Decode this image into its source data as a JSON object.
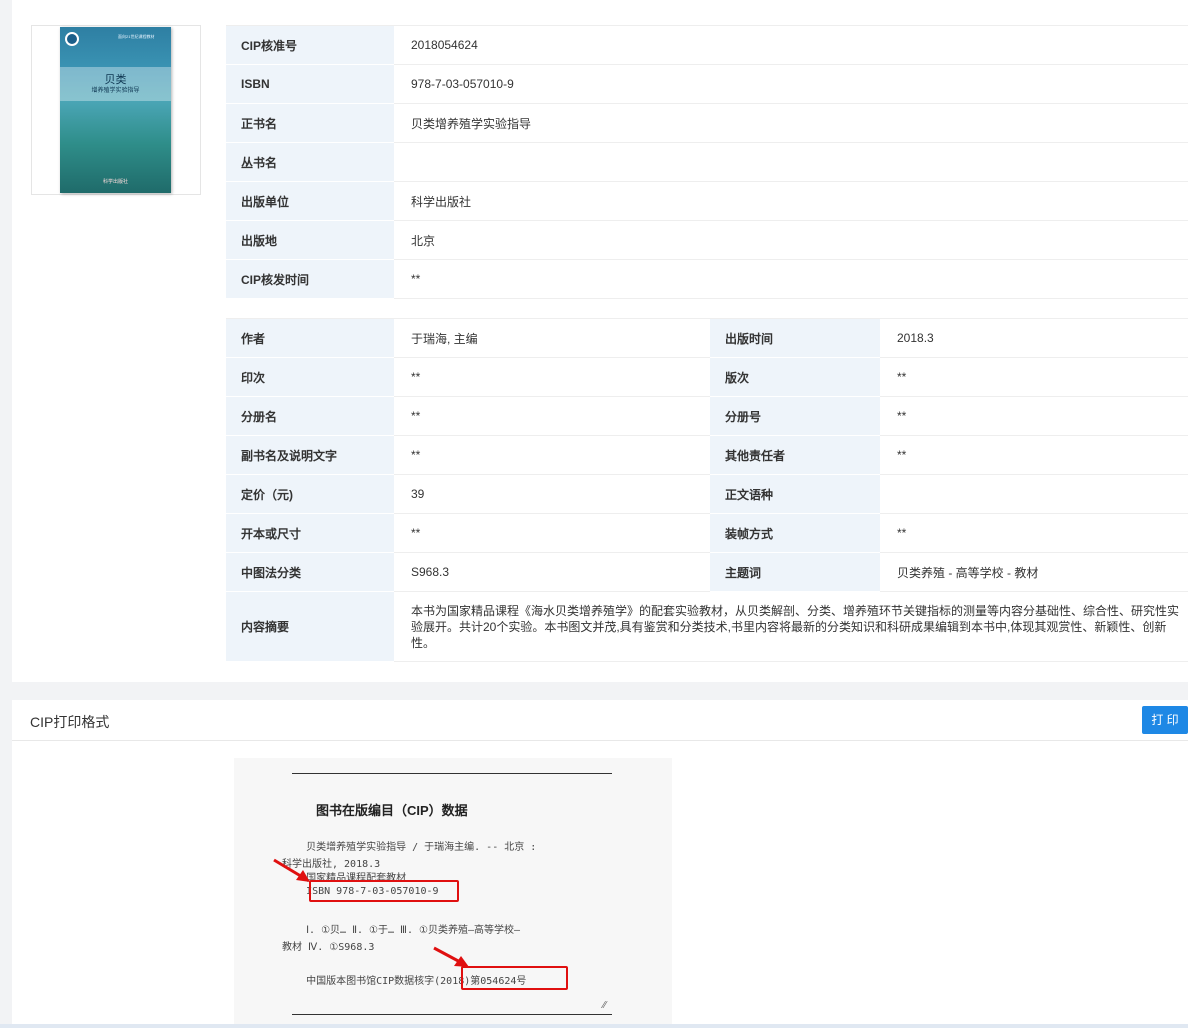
{
  "cover": {
    "series_line": "面向21世纪课程教材",
    "title_main": "贝类",
    "title_sub": "增养殖学实验指导",
    "publisher_mark": "科学出版社"
  },
  "basic_info": [
    {
      "label": "CIP核准号",
      "value": "2018054624"
    },
    {
      "label": "ISBN",
      "value": "978-7-03-057010-9"
    },
    {
      "label": "正书名",
      "value": "贝类增养殖学实验指导"
    },
    {
      "label": "丛书名",
      "value": ""
    },
    {
      "label": "出版单位",
      "value": "科学出版社"
    },
    {
      "label": "出版地",
      "value": "北京"
    },
    {
      "label": "CIP核发时间",
      "value": "**"
    }
  ],
  "detail_info": [
    {
      "l1": "作者",
      "v1": "于瑞海, 主编",
      "l2": "出版时间",
      "v2": "2018.3"
    },
    {
      "l1": "印次",
      "v1": "**",
      "l2": "版次",
      "v2": "**"
    },
    {
      "l1": "分册名",
      "v1": "**",
      "l2": "分册号",
      "v2": "**"
    },
    {
      "l1": "副书名及说明文字",
      "v1": "**",
      "l2": "其他责任者",
      "v2": "**"
    },
    {
      "l1": "定价（元)",
      "v1": "39",
      "l2": "正文语种",
      "v2": ""
    },
    {
      "l1": "开本或尺寸",
      "v1": "**",
      "l2": "装帧方式",
      "v2": "**"
    },
    {
      "l1": "中图法分类",
      "v1": "S968.3",
      "l2": "主题词",
      "v2": "贝类养殖 - 高等学校 - 教材"
    }
  ],
  "abstract": {
    "label": "内容摘要",
    "text": "本书为国家精品课程《海水贝类增养殖学》的配套实验教材，从贝类解剖、分类、增养殖环节关键指标的测量等内容分基础性、综合性、研究性实验展开。共计20个实验。本书图文并茂,具有鉴赏和分类技术,书里内容将最新的分类知识和科研成果编辑到本书中,体现其观赏性、新颖性、创新性。"
  },
  "print_section": {
    "title": "CIP打印格式",
    "print_button": "打 印"
  },
  "cip_record": {
    "heading": "图书在版编目（CIP）数据",
    "line1": "    贝类增养殖学实验指导 / 于瑞海主编. -- 北京 :",
    "line2": "科学出版社, 2018.3",
    "line3": "    国家精品课程配套教材",
    "line4": "    ISBN 978-7-03-057010-9",
    "line5": "    Ⅰ. ①贝… Ⅱ. ①于… Ⅲ. ①贝类养殖—高等学校—",
    "line6": "教材 Ⅳ. ①S968.3",
    "line7": "    中国版本图书馆CIP数据核字(2018)第054624号"
  },
  "colors": {
    "accent": "#1e88e5",
    "label_bg": "#eef4fa",
    "highlight": "#e01010"
  }
}
